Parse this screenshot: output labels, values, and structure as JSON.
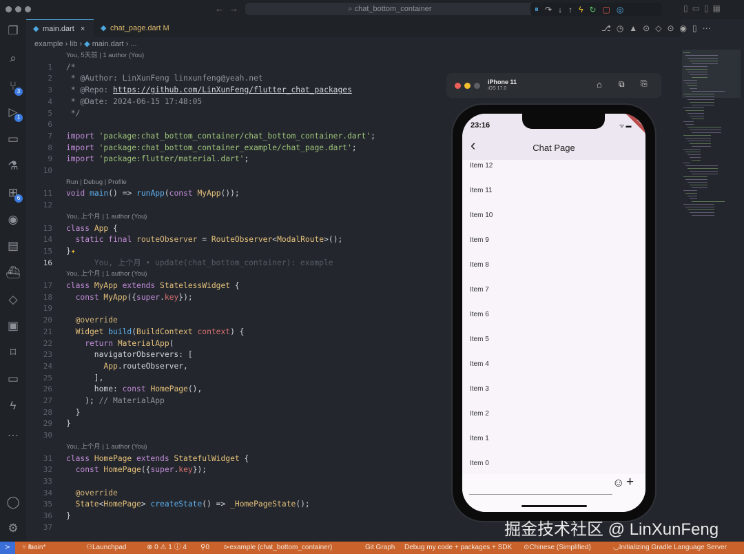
{
  "window": {
    "command_center": "chat_bottom_container"
  },
  "tabs": [
    {
      "label": "main.dart",
      "close": "×",
      "active": true
    },
    {
      "label": "chat_page.dart",
      "badge": "M",
      "active": false
    }
  ],
  "breadcrumb": [
    "example",
    "lib",
    "main.dart",
    "..."
  ],
  "activity_badges": {
    "source_control": "3",
    "run_debug": "1",
    "extensions": "6"
  },
  "editor": {
    "rows": [
      {
        "lens": "You, 5天前 | 1 author (You)"
      },
      {
        "n": "1",
        "seg": [
          [
            "/*",
            "com"
          ]
        ]
      },
      {
        "n": "2",
        "seg": [
          [
            " * @Author: LinXunFeng linxunfeng@yeah.net",
            "com"
          ]
        ]
      },
      {
        "n": "3",
        "seg": [
          [
            " * @Repo: ",
            "com"
          ],
          [
            "https://github.com/LinXunFeng/flutter_chat_packages",
            "link"
          ]
        ]
      },
      {
        "n": "4",
        "seg": [
          [
            " * @Date: 2024-06-15 17:48:05",
            "com"
          ]
        ]
      },
      {
        "n": "5",
        "seg": [
          [
            " */",
            "com"
          ]
        ]
      },
      {
        "n": "6",
        "seg": []
      },
      {
        "n": "7",
        "seg": [
          [
            "import ",
            "kw"
          ],
          [
            "'package:chat_bottom_container/chat_bottom_container.dart'",
            "str"
          ],
          [
            ";",
            "pl"
          ]
        ]
      },
      {
        "n": "8",
        "seg": [
          [
            "import ",
            "kw"
          ],
          [
            "'package:chat_bottom_container_example/chat_page.dart'",
            "str"
          ],
          [
            ";",
            "pl"
          ]
        ]
      },
      {
        "n": "9",
        "seg": [
          [
            "import ",
            "kw"
          ],
          [
            "'package:flutter/material.dart'",
            "str"
          ],
          [
            ";",
            "pl"
          ]
        ]
      },
      {
        "n": "10",
        "seg": []
      },
      {
        "lens": "Run | Debug | Profile"
      },
      {
        "n": "11",
        "seg": [
          [
            "void ",
            "kw"
          ],
          [
            "main",
            "fn"
          ],
          [
            "() => ",
            "pl"
          ],
          [
            "runApp",
            "fn"
          ],
          [
            "(",
            "pl"
          ],
          [
            "const ",
            "kw"
          ],
          [
            "MyApp",
            "cls"
          ],
          [
            "());",
            "pl"
          ]
        ]
      },
      {
        "n": "12",
        "seg": []
      },
      {
        "lens": "You, 上个月 | 1 author (You)"
      },
      {
        "n": "13",
        "seg": [
          [
            "class ",
            "kw"
          ],
          [
            "App ",
            "cls"
          ],
          [
            "{",
            "pl"
          ]
        ]
      },
      {
        "n": "14",
        "seg": [
          [
            "  static final ",
            "kw"
          ],
          [
            "routeObserver",
            "ann"
          ],
          [
            " = ",
            "pl"
          ],
          [
            "RouteObserver",
            "cls"
          ],
          [
            "<",
            "pl"
          ],
          [
            "ModalRoute",
            "cls"
          ],
          [
            ">();",
            "pl"
          ]
        ]
      },
      {
        "n": "15",
        "seg": [
          [
            "}",
            "pl"
          ],
          [
            "✦",
            "star"
          ]
        ]
      },
      {
        "n": "16",
        "cur": true,
        "seg": [
          [
            "      You, 上个月 • update(chat_bottom_container): example",
            "blame"
          ]
        ]
      },
      {
        "lens": "You, 上个月 | 1 author (You)"
      },
      {
        "n": "17",
        "seg": [
          [
            "class ",
            "kw"
          ],
          [
            "MyApp ",
            "cls"
          ],
          [
            "extends ",
            "kw"
          ],
          [
            "StatelessWidget ",
            "cls"
          ],
          [
            "{",
            "pl"
          ]
        ]
      },
      {
        "n": "18",
        "seg": [
          [
            "  const ",
            "kw"
          ],
          [
            "MyApp",
            "cls"
          ],
          [
            "({",
            "pl"
          ],
          [
            "super",
            "kw"
          ],
          [
            ".",
            "pl"
          ],
          [
            "key",
            "par"
          ],
          [
            "});",
            "pl"
          ]
        ]
      },
      {
        "n": "19",
        "seg": []
      },
      {
        "n": "20",
        "seg": [
          [
            "  @override",
            "ann"
          ]
        ]
      },
      {
        "n": "21",
        "seg": [
          [
            "  Widget ",
            "cls"
          ],
          [
            "build",
            "fn"
          ],
          [
            "(",
            "pl"
          ],
          [
            "BuildContext ",
            "cls"
          ],
          [
            "context",
            "par"
          ],
          [
            ") {",
            "pl"
          ]
        ]
      },
      {
        "n": "22",
        "seg": [
          [
            "    return ",
            "kw"
          ],
          [
            "MaterialApp",
            "cls"
          ],
          [
            "(",
            "pl"
          ]
        ]
      },
      {
        "n": "23",
        "seg": [
          [
            "      navigatorObservers: [",
            "pl"
          ]
        ]
      },
      {
        "n": "24",
        "seg": [
          [
            "        App",
            "cls"
          ],
          [
            ".routeObserver,",
            "pl"
          ]
        ]
      },
      {
        "n": "25",
        "seg": [
          [
            "      ],",
            "pl"
          ]
        ]
      },
      {
        "n": "26",
        "seg": [
          [
            "      home: ",
            "pl"
          ],
          [
            "const ",
            "kw"
          ],
          [
            "HomePage",
            "cls"
          ],
          [
            "(),",
            "pl"
          ]
        ]
      },
      {
        "n": "27",
        "seg": [
          [
            "    ); ",
            "pl"
          ],
          [
            "// MaterialApp",
            "com"
          ]
        ]
      },
      {
        "n": "28",
        "seg": [
          [
            "  }",
            "pl"
          ]
        ]
      },
      {
        "n": "29",
        "seg": [
          [
            "}",
            "pl"
          ]
        ]
      },
      {
        "n": "30",
        "seg": []
      },
      {
        "lens": "You, 上个月 | 1 author (You)"
      },
      {
        "n": "31",
        "seg": [
          [
            "class ",
            "kw"
          ],
          [
            "HomePage ",
            "cls"
          ],
          [
            "extends ",
            "kw"
          ],
          [
            "StatefulWidget ",
            "cls"
          ],
          [
            "{",
            "pl"
          ]
        ]
      },
      {
        "n": "32",
        "seg": [
          [
            "  const ",
            "kw"
          ],
          [
            "HomePage",
            "cls"
          ],
          [
            "({",
            "pl"
          ],
          [
            "super",
            "kw"
          ],
          [
            ".",
            "pl"
          ],
          [
            "key",
            "par"
          ],
          [
            "});",
            "pl"
          ]
        ]
      },
      {
        "n": "33",
        "seg": []
      },
      {
        "n": "34",
        "seg": [
          [
            "  @override",
            "ann"
          ]
        ]
      },
      {
        "n": "35",
        "seg": [
          [
            "  State",
            "cls"
          ],
          [
            "<",
            "pl"
          ],
          [
            "HomePage",
            "cls"
          ],
          [
            "> ",
            "pl"
          ],
          [
            "createState",
            "fn"
          ],
          [
            "() => ",
            "pl"
          ],
          [
            "_HomePageState",
            "cls"
          ],
          [
            "();",
            "pl"
          ]
        ]
      },
      {
        "n": "36",
        "seg": [
          [
            "}",
            "pl"
          ]
        ]
      },
      {
        "n": "37",
        "seg": []
      }
    ]
  },
  "simulator": {
    "device": "iPhone 11",
    "os": "iOS 17.0"
  },
  "phone": {
    "time": "23:16",
    "debug_banner": "DEBUG",
    "title": "Chat Page",
    "back": "‹",
    "items": [
      "Item 12",
      "Item 11",
      "Item 10",
      "Item 9",
      "Item 8",
      "Item 7",
      "Item 6",
      "Item 5",
      "Item 4",
      "Item 3",
      "Item 2",
      "Item 1",
      "Item 0"
    ],
    "emoji": "☺",
    "plus": "+"
  },
  "statusbar": {
    "branch": "main*",
    "launchpad": "Launchpad",
    "problems": "⊗ 0 ⚠ 1 ⓘ 4",
    "ports": "0",
    "target": "example (chat_bottom_container)",
    "git_graph": "Git Graph",
    "debug_mode": "Debug my code + packages + SDK",
    "language": "Chinese (Simplified)",
    "progress": "Initializing Gradle Language Server"
  },
  "watermark": "掘金技术社区 @ LinXunFeng",
  "colors": {
    "status_bar": "#c9632b",
    "accent": "#3c7be0"
  }
}
